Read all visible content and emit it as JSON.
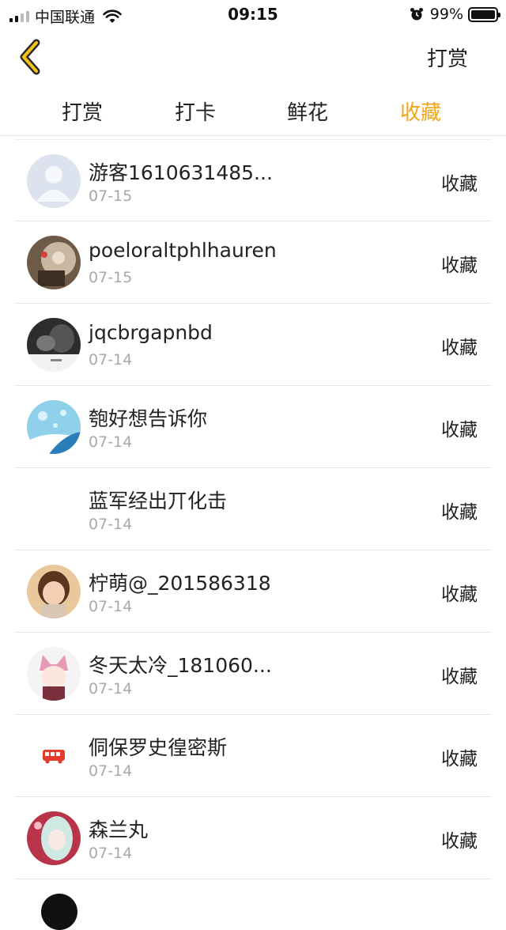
{
  "status_bar": {
    "carrier": "中国联通",
    "time": "09:15",
    "battery": "99%",
    "icons": [
      "signal-icon",
      "wifi-icon",
      "alarm-icon",
      "battery-icon"
    ]
  },
  "navbar": {
    "back_icon": "chevron-left-icon",
    "action": "打赏"
  },
  "tabs": [
    {
      "label": "打赏",
      "active": false
    },
    {
      "label": "打卡",
      "active": false
    },
    {
      "label": "鲜花",
      "active": false
    },
    {
      "label": "收藏",
      "active": true
    }
  ],
  "colors": {
    "accent": "#f0a518",
    "date": "#a8a8a8",
    "divider": "#e8e8e8"
  },
  "rows": [
    {
      "name": "游客1610631485...",
      "date": "07-15",
      "action": "收藏",
      "avatar": "default-avatar-icon"
    },
    {
      "name": "poeloraltphlhauren",
      "date": "07-15",
      "action": "收藏",
      "avatar": "user-avatar"
    },
    {
      "name": "jqcbrgapnbd",
      "date": "07-14",
      "action": "收藏",
      "avatar": "user-avatar"
    },
    {
      "name": "匏好想告诉你",
      "date": "07-14",
      "action": "收藏",
      "avatar": "user-avatar"
    },
    {
      "name": "蓝军经出丌化击",
      "date": "07-14",
      "action": "收藏",
      "avatar": "none"
    },
    {
      "name": "柠萌@_201586318",
      "date": "07-14",
      "action": "收藏",
      "avatar": "user-avatar"
    },
    {
      "name": "冬天太冷_181060...",
      "date": "07-14",
      "action": "收藏",
      "avatar": "user-avatar"
    },
    {
      "name": "侗保罗史徨密斯",
      "date": "07-14",
      "action": "收藏",
      "avatar": "bus-icon"
    },
    {
      "name": "森兰丸",
      "date": "07-14",
      "action": "收藏",
      "avatar": "user-avatar"
    }
  ]
}
